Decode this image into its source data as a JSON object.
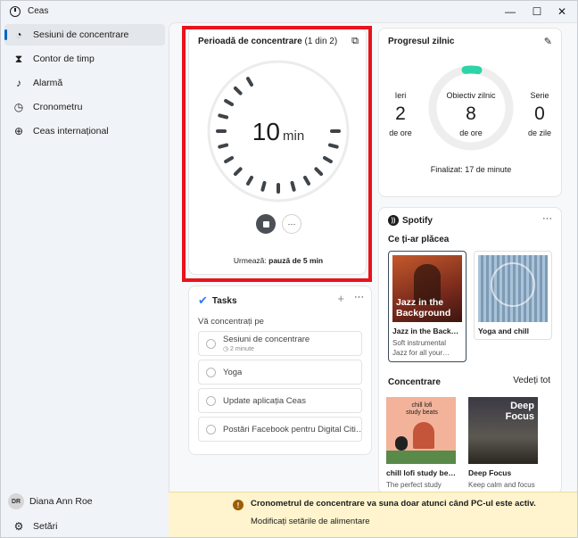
{
  "app": {
    "title": "Ceas",
    "minimize_glyph": "—",
    "maximize_glyph": "☐",
    "close_glyph": "✕"
  },
  "sidebar": {
    "items": [
      {
        "label": "Sesiuni de concentrare",
        "icon": "focus-icon",
        "glyph": "◔",
        "active": true
      },
      {
        "label": "Contor de timp",
        "icon": "hourglass-icon",
        "glyph": "⧗",
        "active": false
      },
      {
        "label": "Alarmă",
        "icon": "bell-icon",
        "glyph": "♪",
        "active": false
      },
      {
        "label": "Cronometru",
        "icon": "stopwatch-icon",
        "glyph": "◷",
        "active": false
      },
      {
        "label": "Ceas internațional",
        "icon": "globe-icon",
        "glyph": "⊕",
        "active": false
      }
    ],
    "user": {
      "initials": "DR",
      "name": "Diana Ann Roe"
    },
    "settings": {
      "label": "Setări",
      "icon": "gear-icon",
      "glyph": "⚙"
    }
  },
  "focus": {
    "title": "Perioadă de concentrare",
    "counter": "(1 din 2)",
    "value": "10",
    "unit": "min",
    "next_prefix": "Urmează:",
    "next_value": "pauză de 5 min",
    "more_glyph": "···",
    "compact_glyph": "⧉"
  },
  "progress": {
    "title": "Progresul zilnic",
    "edit_glyph": "✎",
    "yesterday": {
      "label": "Ieri",
      "value": "2",
      "unit": "de ore"
    },
    "goal": {
      "label": "Obiectiv zilnic",
      "value": "8",
      "unit": "de ore"
    },
    "streak": {
      "label": "Serie",
      "value": "0",
      "unit": "de zile"
    },
    "completed": "Finalizat: 17 de minute",
    "accent": "#2ed3a7"
  },
  "spotify": {
    "brand": "Spotify",
    "more_glyph": "···",
    "section1": "Ce ți-ar plăcea",
    "section2": "Concentrare",
    "see_all": "Vedeți tot",
    "tiles1": [
      {
        "name": "Jazz in the Backgr…",
        "art_label": "Jazz in the Background",
        "desc": "Soft instrumental Jazz for all your…"
      },
      {
        "name": "Yoga and chill",
        "art_label": "",
        "desc": ""
      }
    ],
    "tiles2": [
      {
        "name": "chill lofi study beats",
        "art_label": "chill lofi study beats",
        "desc": "The perfect study"
      },
      {
        "name": "Deep Focus",
        "art_label": "Deep Focus",
        "desc": "Keep calm and focus"
      }
    ]
  },
  "tasks": {
    "title": "Tasks",
    "add_glyph": "+",
    "more_glyph": "···",
    "subtitle": "Vă concentrați pe",
    "items": [
      {
        "label": "Sesiuni de concentrare",
        "sub": "◷ 2 minute"
      },
      {
        "label": "Yoga",
        "sub": ""
      },
      {
        "label": "Update aplicația Ceas",
        "sub": ""
      },
      {
        "label": "Postări Facebook pentru Digital Citi…",
        "sub": ""
      }
    ]
  },
  "notification": {
    "message": "Cronometrul de concentrare va suna doar atunci când PC-ul este activ.",
    "link": "Modificați setările de alimentare",
    "icon_glyph": "!"
  }
}
